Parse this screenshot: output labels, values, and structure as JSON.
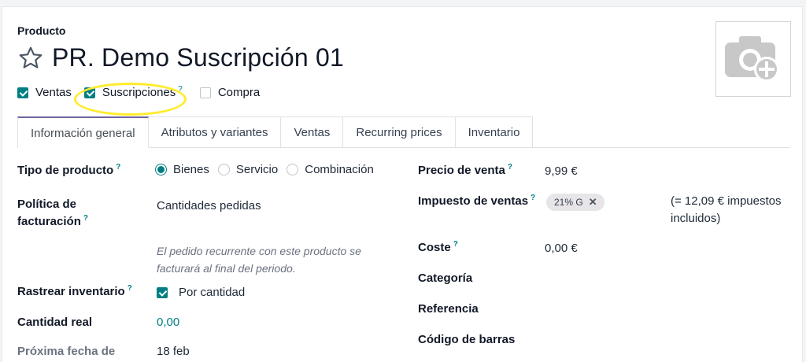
{
  "header": {
    "label": "Producto",
    "title": "PR. Demo Suscripción 01",
    "star_icon": "star-outline-icon",
    "image_icon": "camera-plus-icon"
  },
  "flags": {
    "sales": {
      "label": "Ventas",
      "checked": true
    },
    "subscriptions": {
      "label": "Suscripciones",
      "help": "?",
      "checked": true
    },
    "purchase": {
      "label": "Compra",
      "checked": false
    }
  },
  "tabs": [
    {
      "label": "Información general",
      "active": true
    },
    {
      "label": "Atributos y variantes"
    },
    {
      "label": "Ventas"
    },
    {
      "label": "Recurring prices"
    },
    {
      "label": "Inventario"
    }
  ],
  "left": {
    "product_type": {
      "label": "Tipo de producto",
      "help": "?",
      "options": [
        "Bienes",
        "Servicio",
        "Combinación"
      ],
      "selected": "Bienes"
    },
    "invoice_policy": {
      "label_line1": "Política de",
      "label_line2": "facturación",
      "help": "?",
      "value": "Cantidades pedidas",
      "note_line1": "El pedido recurrente con este producto se",
      "note_line2": "facturará al final del periodo."
    },
    "track_inventory": {
      "label": "Rastrear inventario",
      "help": "?",
      "value": "Por cantidad",
      "checked": true
    },
    "real_qty": {
      "label": "Cantidad real",
      "value": "0,00"
    },
    "next_date": {
      "label": "Próxima fecha de",
      "value": "18 feb"
    }
  },
  "right": {
    "sale_price": {
      "label": "Precio de venta",
      "help": "?",
      "value": "9,99 €"
    },
    "sales_tax": {
      "label": "Impuesto de ventas",
      "help": "?",
      "tag": "21% G",
      "tag_remove": "✕",
      "note_line1": "(= 12,09 € impuestos",
      "note_line2": "incluidos)"
    },
    "cost": {
      "label": "Coste",
      "help": "?",
      "value": "0,00 €"
    },
    "category": {
      "label": "Categoría"
    },
    "reference": {
      "label": "Referencia"
    },
    "barcode": {
      "label": "Código de barras"
    }
  },
  "colors": {
    "accent": "#017e84",
    "tab_active": "#71639e",
    "highlight": "#ffec2c"
  }
}
